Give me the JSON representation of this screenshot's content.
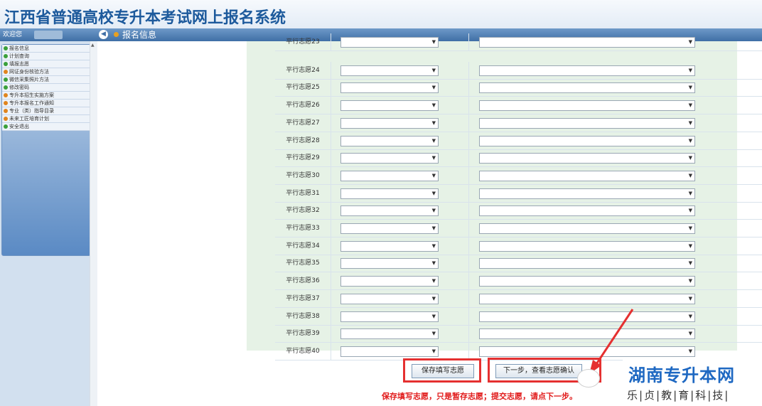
{
  "app": {
    "title": "江西省普通高校专升本考试网上报名系统"
  },
  "topbar": {
    "welcome": "欢迎您",
    "breadcrumb": "报名信息"
  },
  "sidebar": {
    "items": [
      {
        "label": "报名信息",
        "icon": "green"
      },
      {
        "label": "计划查询",
        "icon": "green"
      },
      {
        "label": "填报志愿",
        "icon": "green"
      },
      {
        "label": "网证身份核验方法",
        "icon": "orange"
      },
      {
        "label": "微信采集照片方法",
        "icon": "green"
      },
      {
        "label": "修改密码",
        "icon": "green"
      },
      {
        "label": "专升本招生实施方案",
        "icon": "orange"
      },
      {
        "label": "专升本报名工作通知",
        "icon": "orange"
      },
      {
        "label": "专业（类）指导目录",
        "icon": "orange"
      },
      {
        "label": "未来工匠培育计划",
        "icon": "orange"
      },
      {
        "label": "安全退出",
        "icon": "green"
      }
    ]
  },
  "rows": [
    "平行志愿23",
    "平行志愿24",
    "平行志愿25",
    "平行志愿26",
    "平行志愿27",
    "平行志愿28",
    "平行志愿29",
    "平行志愿30",
    "平行志愿31",
    "平行志愿32",
    "平行志愿33",
    "平行志愿34",
    "平行志愿35",
    "平行志愿36",
    "平行志愿37",
    "平行志愿38",
    "平行志愿39",
    "平行志愿40"
  ],
  "buttons": {
    "save": "保存填写志愿",
    "next": "下一步，查看志愿确认"
  },
  "note": "保存填写志愿，只是暂存志愿；提交志愿，请点下一步。",
  "watermark": {
    "title": "湖南专升本网",
    "subtitle": "乐|贞|教|育|科|技|"
  },
  "colors": {
    "accent": "#1d5a9c",
    "highlight": "#e53030",
    "note": "#e11b1b"
  }
}
